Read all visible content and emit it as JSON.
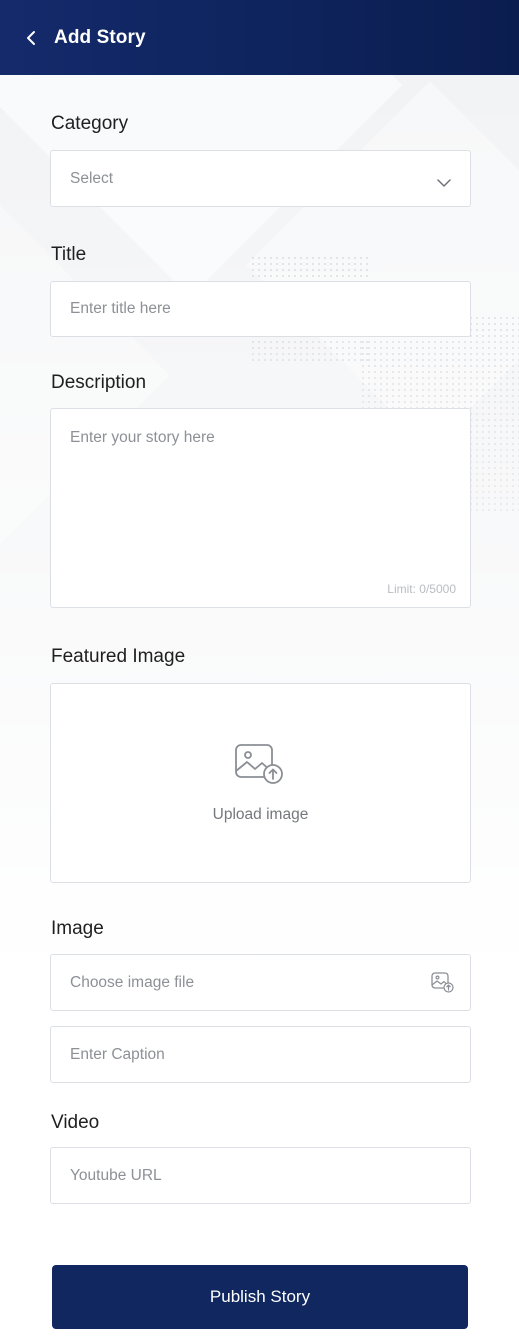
{
  "header": {
    "title": "Add Story",
    "background": "#10275f"
  },
  "form": {
    "category": {
      "label": "Category",
      "selected": "Select"
    },
    "title": {
      "label": "Title",
      "placeholder": "Enter title here"
    },
    "description": {
      "label": "Description",
      "placeholder": "Enter your story here",
      "limit_text": "Limit: 0/5000"
    },
    "featured_image": {
      "label": "Featured Image",
      "upload_text": "Upload image"
    },
    "image": {
      "label": "Image",
      "file_placeholder": "Choose image file",
      "caption_placeholder": "Enter Caption"
    },
    "video": {
      "label": "Video",
      "url_placeholder": "Youtube URL"
    }
  },
  "actions": {
    "publish_label": "Publish Story"
  },
  "icons": {
    "back": "chevron-left-icon",
    "select": "chevron-down-icon",
    "upload": "image-upload-icon"
  }
}
